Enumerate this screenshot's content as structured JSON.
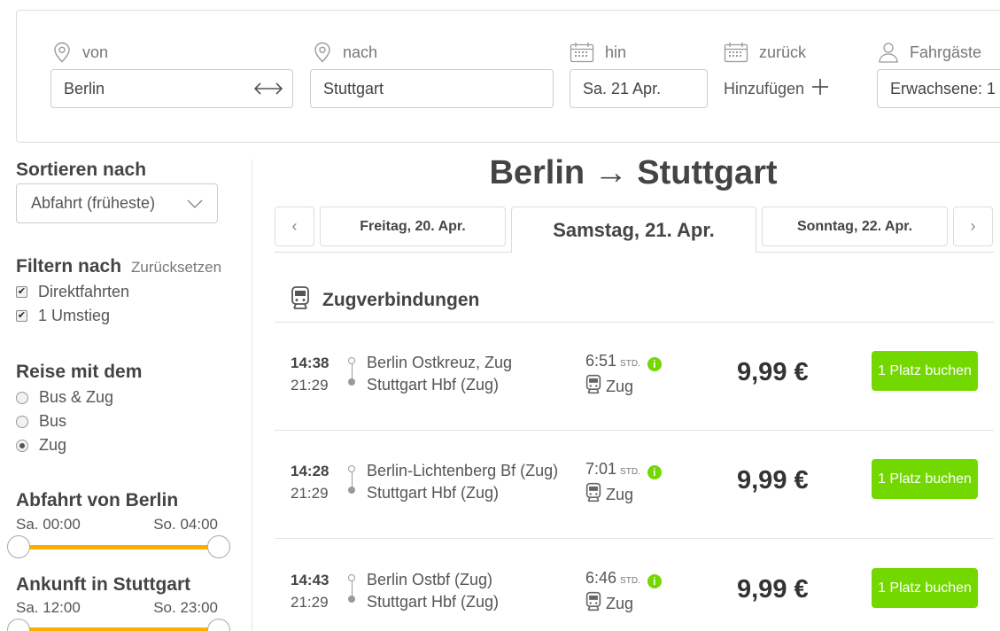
{
  "search": {
    "from_label": "von",
    "from_value": "Berlin",
    "to_label": "nach",
    "to_value": "Stuttgart",
    "outbound_label": "hin",
    "outbound_value": "Sa. 21 Apr.",
    "return_label": "zurück",
    "return_add": "Hinzufügen",
    "passengers_label": "Fahrgäste",
    "passengers_value": "Erwachsene: 1"
  },
  "sidebar": {
    "sort_heading": "Sortieren nach",
    "sort_value": "Abfahrt (früheste)",
    "filter_heading": "Filtern nach",
    "filter_reset": "Zurücksetzen",
    "filters": [
      {
        "label": "Direktfahrten",
        "checked": true
      },
      {
        "label": "1 Umstieg",
        "checked": true
      }
    ],
    "travel_heading": "Reise mit dem",
    "travel_options": [
      {
        "label": "Bus & Zug",
        "selected": false
      },
      {
        "label": "Bus",
        "selected": false
      },
      {
        "label": "Zug",
        "selected": true
      }
    ],
    "departure_heading": "Abfahrt von Berlin",
    "departure_min": "Sa. 00:00",
    "departure_max": "So. 04:00",
    "arrival_heading": "Ankunft in Stuttgart",
    "arrival_min": "Sa. 12:00",
    "arrival_max": "So. 23:00"
  },
  "main": {
    "route_title": "Berlin → Stuttgart",
    "prev_arrow": "‹",
    "next_arrow": "›",
    "days": [
      {
        "label": "Freitag, 20. Apr.",
        "active": false
      },
      {
        "label": "Samstag, 21. Apr.",
        "active": true
      },
      {
        "label": "Sonntag, 22. Apr.",
        "active": false
      }
    ],
    "section_title": "Zugverbindungen",
    "trips": [
      {
        "dep": "14:38",
        "arr": "21:29",
        "from": "Berlin Ostkreuz, Zug",
        "to": "Stuttgart Hbf (Zug)",
        "duration": "6:51",
        "unit": "STD.",
        "mode": "Zug",
        "price": "9,99 €",
        "button": "1 Platz buchen"
      },
      {
        "dep": "14:28",
        "arr": "21:29",
        "from": "Berlin-Lichtenberg Bf (Zug)",
        "to": "Stuttgart Hbf (Zug)",
        "duration": "7:01",
        "unit": "STD.",
        "mode": "Zug",
        "price": "9,99 €",
        "button": "1 Platz buchen"
      },
      {
        "dep": "14:43",
        "arr": "21:29",
        "from": "Berlin Ostbf (Zug)",
        "to": "Stuttgart Hbf (Zug)",
        "duration": "6:46",
        "unit": "STD.",
        "mode": "Zug",
        "price": "9,99 €",
        "button": "1 Platz buchen"
      }
    ]
  },
  "colors": {
    "accent": "#73d700",
    "slider": "#ffad00",
    "text": "#444444"
  },
  "icons": [
    "location-pin-icon",
    "swap-arrows-icon",
    "calendar-icon",
    "plus-icon",
    "person-icon",
    "chevron-down-icon",
    "train-icon",
    "info-icon"
  ]
}
